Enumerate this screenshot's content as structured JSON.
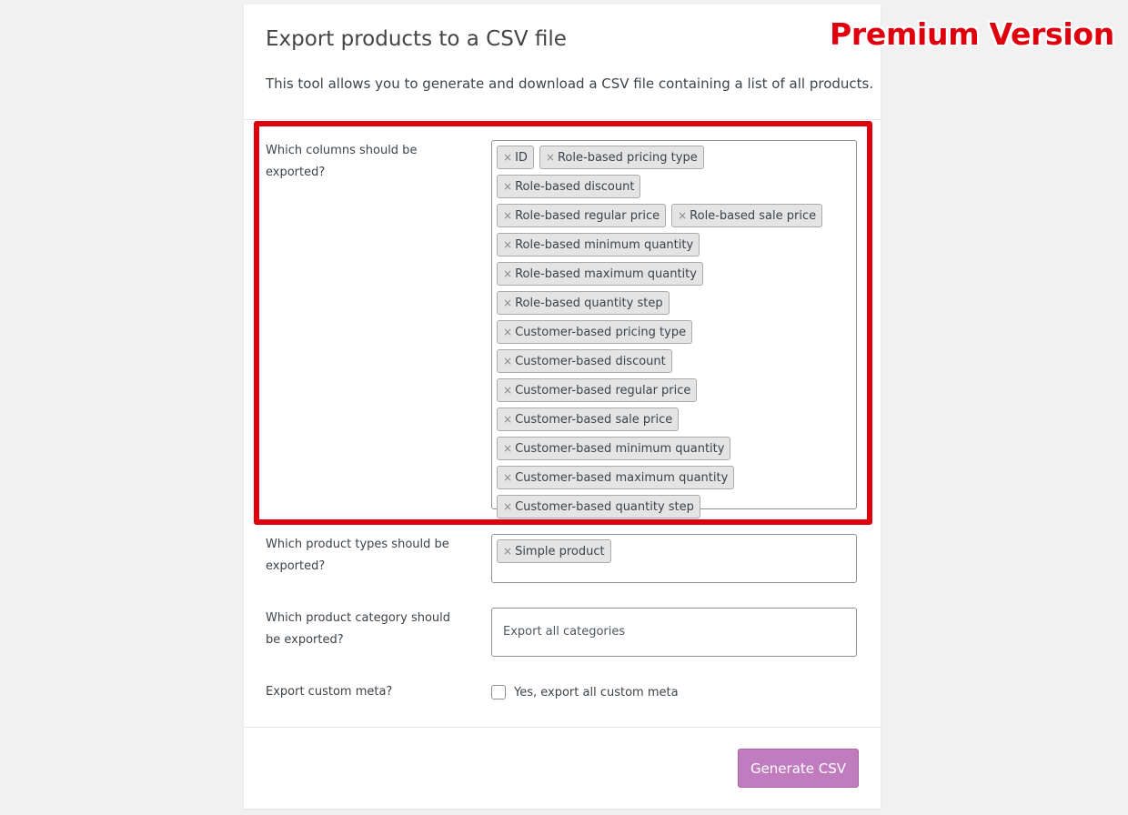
{
  "header": {
    "title": "Export products to a CSV file",
    "description": "This tool allows you to generate and download a CSV file containing a list of all products."
  },
  "badge": {
    "text": "Premium Version",
    "color": "#e0000d"
  },
  "columns": {
    "label": "Which columns should be exported?",
    "remove_symbol": "×",
    "items": [
      "ID",
      "Role-based pricing type",
      "Role-based discount",
      "Role-based regular price",
      "Role-based sale price",
      "Role-based minimum quantity",
      "Role-based maximum quantity",
      "Role-based quantity step",
      "Customer-based pricing type",
      "Customer-based discount",
      "Customer-based regular price",
      "Customer-based sale price",
      "Customer-based minimum quantity",
      "Customer-based maximum quantity",
      "Customer-based quantity step"
    ]
  },
  "product_types": {
    "label": "Which product types should be exported?",
    "items": [
      "Simple product"
    ]
  },
  "category": {
    "label": "Which product category should be exported?",
    "placeholder": "Export all categories"
  },
  "custom_meta": {
    "label": "Export custom meta?",
    "checkbox_label": "Yes, export all custom meta",
    "checked": false
  },
  "actions": {
    "generate_label": "Generate CSV",
    "button_color": "#c17cc0"
  }
}
